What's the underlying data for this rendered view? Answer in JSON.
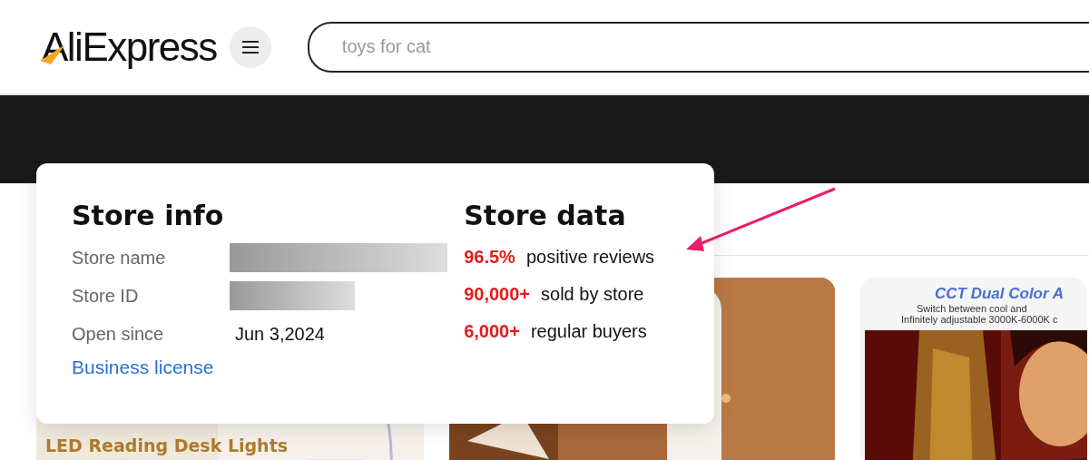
{
  "header": {
    "logo": "AliExpress",
    "search": {
      "placeholder": "toys for cat"
    }
  },
  "store_popup": {
    "info": {
      "title": "Store info",
      "rows": [
        {
          "label": "Store name",
          "value_redacted": true
        },
        {
          "label": "Store ID",
          "value_redacted": true
        },
        {
          "label": "Open since",
          "value": "Jun 3,2024"
        }
      ],
      "link": "Business license"
    },
    "data": {
      "title": "Store data",
      "stats": [
        {
          "value": "96.5%",
          "label": "positive reviews"
        },
        {
          "value": "90,000+",
          "label": "sold by store"
        },
        {
          "value": "6,000+",
          "label": "regular buyers"
        }
      ]
    }
  },
  "products": [
    {
      "kind": "light",
      "title": "LED Reading Desk Lights"
    },
    {
      "kind": "wood"
    },
    {
      "kind": "promo",
      "title": "CCT Dual Color A",
      "subtitle": [
        "Switch between cool and",
        "Infinitely adjustable 3000K-6000K c"
      ]
    }
  ]
}
